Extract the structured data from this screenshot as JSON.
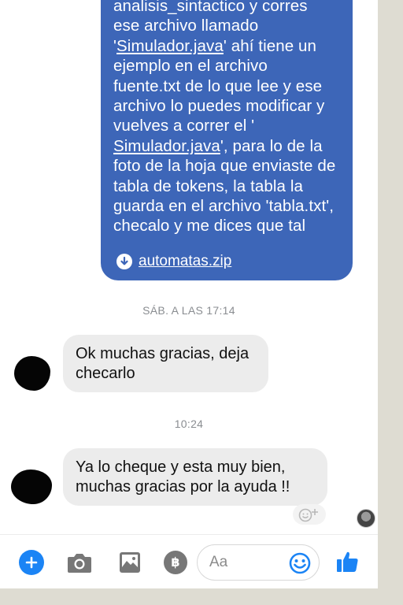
{
  "conversation": {
    "outgoing_message": {
      "lines_before_link1": "analisis_sintactico y corres\nese archivo llamado\n'",
      "link1": "Simulador.java",
      "lines_between": "' ahí tiene un\nejemplo en el archivo\nfuente.txt de lo que lee y ese\narchivo lo puedes modificar y\nvuelves a correr el '\n",
      "link2": "Simulador.java",
      "lines_after": "', para lo de la\nfoto de la hoja que enviaste de\ntabla de tokens, la tabla la\nguarda en el archivo 'tabla.txt',\nchecalo y me dices que tal",
      "attachment_name": "automatas.zip",
      "attachment_icon": "download-icon"
    },
    "timestamp_1": "SÁB. A LAS 17:14",
    "incoming_message_1": "Ok muchas gracias, deja\nchecarlo",
    "timestamp_2": "10:24",
    "incoming_message_2": "Ya lo cheque y esta muy bien,\nmuchas gracias por la ayuda !!",
    "reaction_icon": "add-reaction-icon",
    "seen_indicator": "seen-avatar"
  },
  "composer": {
    "placeholder": "Aa",
    "plus_icon": "plus-icon",
    "camera_icon": "camera-icon",
    "gallery_icon": "gallery-icon",
    "payment_label": "฿",
    "emoji_icon": "emoji-icon",
    "like_icon": "thumbs-up-icon"
  },
  "colors": {
    "outgoing_bubble": "#3d66b8",
    "incoming_bubble": "#ececec",
    "accent": "#1b84f5",
    "page_background": "#dedcd2"
  }
}
